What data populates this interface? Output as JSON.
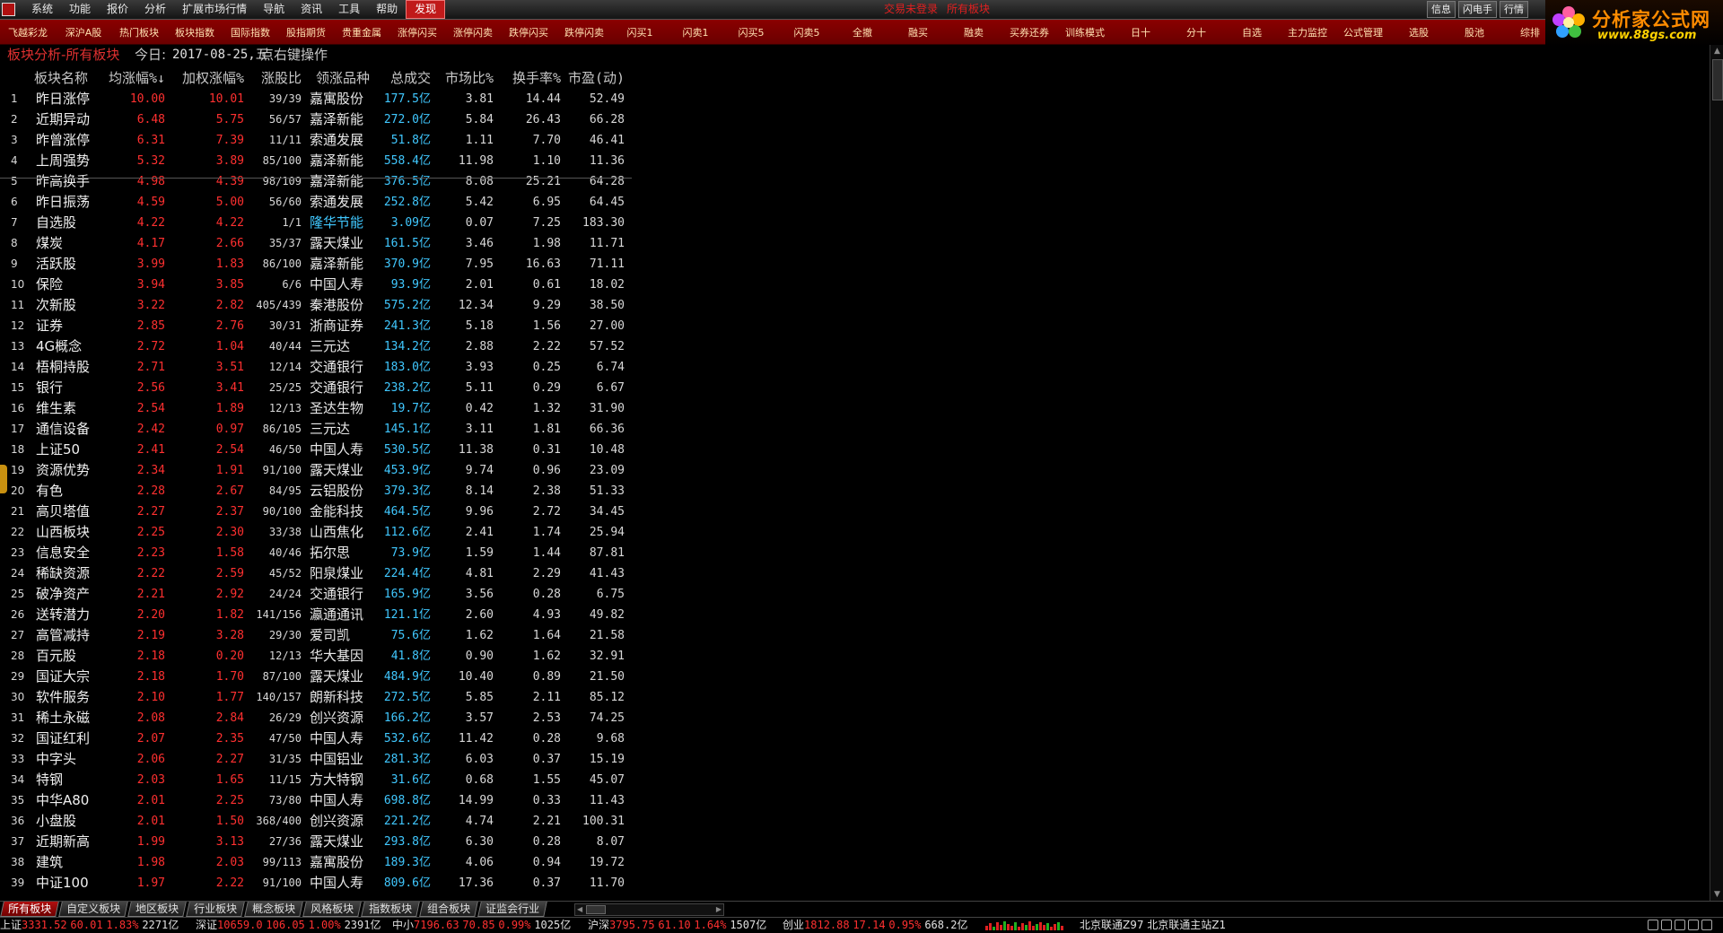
{
  "menubar": {
    "items": [
      "系统",
      "功能",
      "报价",
      "分析",
      "扩展市场行情",
      "导航",
      "资讯",
      "工具",
      "帮助",
      "发现"
    ],
    "status_msg": "交易未登录",
    "status_scope": "所有板块",
    "right_buttons": [
      "信息",
      "闪电手",
      "行情"
    ]
  },
  "brand": {
    "title": "分析家公式网",
    "url": "www.88gs.com"
  },
  "toolbar": {
    "items": [
      "飞越彩龙",
      "深沪A股",
      "热门板块",
      "板块指数",
      "国际指数",
      "股指期货",
      "贵重金属",
      "涨停闪买",
      "涨停闪卖",
      "跌停闪买",
      "跌停闪卖",
      "闪买1",
      "闪卖1",
      "闪买5",
      "闪卖5",
      "全撤",
      "融买",
      "融卖",
      "买券还券",
      "训练模式",
      "日十",
      "分十",
      "自选",
      "主力监控",
      "公式管理",
      "选股",
      "股池",
      "综排"
    ]
  },
  "panel": {
    "title": "板块分析-所有板块",
    "today_label": "今日:",
    "today_date": "2017-08-25,五",
    "hint": "点右键操作"
  },
  "table": {
    "headers": {
      "name": "板块名称",
      "avg": "均涨幅%",
      "weighted": "加权涨幅%",
      "ratio": "涨股比",
      "leader": "领涨品种",
      "volume": "总成交",
      "market": "市场比%",
      "turnover": "换手率%",
      "pe": "市盈(动)"
    },
    "rows": [
      {
        "idx": "1",
        "name": "昨日涨停",
        "avg": "10.00",
        "weighted": "10.01",
        "ratio": "39/39",
        "leader": "嘉寓股份",
        "volume": "177.5亿",
        "market": "3.81",
        "turnover": "14.44",
        "pe": "52.49"
      },
      {
        "idx": "2",
        "name": "近期异动",
        "avg": "6.48",
        "weighted": "5.75",
        "ratio": "56/57",
        "leader": "嘉泽新能",
        "volume": "272.0亿",
        "market": "5.84",
        "turnover": "26.43",
        "pe": "66.28"
      },
      {
        "idx": "3",
        "name": "昨曾涨停",
        "avg": "6.31",
        "weighted": "7.39",
        "ratio": "11/11",
        "leader": "索通发展",
        "volume": "51.8亿",
        "market": "1.11",
        "turnover": "7.70",
        "pe": "46.41"
      },
      {
        "idx": "4",
        "name": "上周强势",
        "avg": "5.32",
        "weighted": "3.89",
        "ratio": "85/100",
        "leader": "嘉泽新能",
        "volume": "558.4亿",
        "market": "11.98",
        "turnover": "1.10",
        "pe": "11.36"
      },
      {
        "idx": "5",
        "name": "昨高换手",
        "avg": "4.98",
        "weighted": "4.39",
        "ratio": "98/109",
        "leader": "嘉泽新能",
        "volume": "376.5亿",
        "market": "8.08",
        "turnover": "25.21",
        "pe": "64.28"
      },
      {
        "idx": "6",
        "name": "昨日振荡",
        "avg": "4.59",
        "weighted": "5.00",
        "ratio": "56/60",
        "leader": "索通发展",
        "volume": "252.8亿",
        "market": "5.42",
        "turnover": "6.95",
        "pe": "64.45"
      },
      {
        "idx": "7",
        "name": "自选股",
        "avg": "4.22",
        "weighted": "4.22",
        "ratio": "1/1",
        "leader": "隆华节能",
        "leader_cyan": true,
        "volume": "3.09亿",
        "market": "0.07",
        "turnover": "7.25",
        "pe": "183.30"
      },
      {
        "idx": "8",
        "name": "煤炭",
        "avg": "4.17",
        "weighted": "2.66",
        "ratio": "35/37",
        "leader": "露天煤业",
        "volume": "161.5亿",
        "market": "3.46",
        "turnover": "1.98",
        "pe": "11.71"
      },
      {
        "idx": "9",
        "name": "活跃股",
        "avg": "3.99",
        "weighted": "1.83",
        "ratio": "86/100",
        "leader": "嘉泽新能",
        "volume": "370.9亿",
        "market": "7.95",
        "turnover": "16.63",
        "pe": "71.11"
      },
      {
        "idx": "10",
        "name": "保险",
        "avg": "3.94",
        "weighted": "3.85",
        "ratio": "6/6",
        "leader": "中国人寿",
        "volume": "93.9亿",
        "market": "2.01",
        "turnover": "0.61",
        "pe": "18.02"
      },
      {
        "idx": "11",
        "name": "次新股",
        "avg": "3.22",
        "weighted": "2.82",
        "ratio": "405/439",
        "leader": "秦港股份",
        "volume": "575.2亿",
        "market": "12.34",
        "turnover": "9.29",
        "pe": "38.50"
      },
      {
        "idx": "12",
        "name": "证券",
        "avg": "2.85",
        "weighted": "2.76",
        "ratio": "30/31",
        "leader": "浙商证券",
        "volume": "241.3亿",
        "market": "5.18",
        "turnover": "1.56",
        "pe": "27.00"
      },
      {
        "idx": "13",
        "name": "4G概念",
        "avg": "2.72",
        "weighted": "1.04",
        "ratio": "40/44",
        "leader": "三元达",
        "volume": "134.2亿",
        "market": "2.88",
        "turnover": "2.22",
        "pe": "57.52"
      },
      {
        "idx": "14",
        "name": "梧桐持股",
        "avg": "2.71",
        "weighted": "3.51",
        "ratio": "12/14",
        "leader": "交通银行",
        "volume": "183.0亿",
        "market": "3.93",
        "turnover": "0.25",
        "pe": "6.74"
      },
      {
        "idx": "15",
        "name": "银行",
        "avg": "2.56",
        "weighted": "3.41",
        "ratio": "25/25",
        "leader": "交通银行",
        "volume": "238.2亿",
        "market": "5.11",
        "turnover": "0.29",
        "pe": "6.67"
      },
      {
        "idx": "16",
        "name": "维生素",
        "avg": "2.54",
        "weighted": "1.89",
        "ratio": "12/13",
        "leader": "圣达生物",
        "volume": "19.7亿",
        "market": "0.42",
        "turnover": "1.32",
        "pe": "31.90"
      },
      {
        "idx": "17",
        "name": "通信设备",
        "avg": "2.42",
        "weighted": "0.97",
        "ratio": "86/105",
        "leader": "三元达",
        "volume": "145.1亿",
        "market": "3.11",
        "turnover": "1.81",
        "pe": "66.36"
      },
      {
        "idx": "18",
        "name": "上证50",
        "avg": "2.41",
        "weighted": "2.54",
        "ratio": "46/50",
        "leader": "中国人寿",
        "volume": "530.5亿",
        "market": "11.38",
        "turnover": "0.31",
        "pe": "10.48"
      },
      {
        "idx": "19",
        "name": "资源优势",
        "avg": "2.34",
        "weighted": "1.91",
        "ratio": "91/100",
        "leader": "露天煤业",
        "volume": "453.9亿",
        "market": "9.74",
        "turnover": "0.96",
        "pe": "23.09"
      },
      {
        "idx": "20",
        "name": "有色",
        "avg": "2.28",
        "weighted": "2.67",
        "ratio": "84/95",
        "leader": "云铝股份",
        "volume": "379.3亿",
        "market": "8.14",
        "turnover": "2.38",
        "pe": "51.33"
      },
      {
        "idx": "21",
        "name": "高贝塔值",
        "avg": "2.27",
        "weighted": "2.37",
        "ratio": "90/100",
        "leader": "金能科技",
        "volume": "464.5亿",
        "market": "9.96",
        "turnover": "2.72",
        "pe": "34.45"
      },
      {
        "idx": "22",
        "name": "山西板块",
        "avg": "2.25",
        "weighted": "2.30",
        "ratio": "33/38",
        "leader": "山西焦化",
        "volume": "112.6亿",
        "market": "2.41",
        "turnover": "1.74",
        "pe": "25.94"
      },
      {
        "idx": "23",
        "name": "信息安全",
        "avg": "2.23",
        "weighted": "1.58",
        "ratio": "40/46",
        "leader": "拓尔思",
        "volume": "73.9亿",
        "market": "1.59",
        "turnover": "1.44",
        "pe": "87.81"
      },
      {
        "idx": "24",
        "name": "稀缺资源",
        "avg": "2.22",
        "weighted": "2.59",
        "ratio": "45/52",
        "leader": "阳泉煤业",
        "volume": "224.4亿",
        "market": "4.81",
        "turnover": "2.29",
        "pe": "41.43"
      },
      {
        "idx": "25",
        "name": "破净资产",
        "avg": "2.21",
        "weighted": "2.92",
        "ratio": "24/24",
        "leader": "交通银行",
        "volume": "165.9亿",
        "market": "3.56",
        "turnover": "0.28",
        "pe": "6.75"
      },
      {
        "idx": "26",
        "name": "送转潜力",
        "avg": "2.20",
        "weighted": "1.82",
        "ratio": "141/156",
        "leader": "瀛通通讯",
        "volume": "121.1亿",
        "market": "2.60",
        "turnover": "4.93",
        "pe": "49.82"
      },
      {
        "idx": "27",
        "name": "高管减持",
        "avg": "2.19",
        "weighted": "3.28",
        "ratio": "29/30",
        "leader": "爱司凯",
        "volume": "75.6亿",
        "market": "1.62",
        "turnover": "1.64",
        "pe": "21.58"
      },
      {
        "idx": "28",
        "name": "百元股",
        "avg": "2.18",
        "weighted": "0.20",
        "ratio": "12/13",
        "leader": "华大基因",
        "volume": "41.8亿",
        "market": "0.90",
        "turnover": "1.62",
        "pe": "32.91"
      },
      {
        "idx": "29",
        "name": "国证大宗",
        "avg": "2.18",
        "weighted": "1.70",
        "ratio": "87/100",
        "leader": "露天煤业",
        "volume": "484.9亿",
        "market": "10.40",
        "turnover": "0.89",
        "pe": "21.50"
      },
      {
        "idx": "30",
        "name": "软件服务",
        "avg": "2.10",
        "weighted": "1.77",
        "ratio": "140/157",
        "leader": "朗新科技",
        "volume": "272.5亿",
        "market": "5.85",
        "turnover": "2.11",
        "pe": "85.12"
      },
      {
        "idx": "31",
        "name": "稀土永磁",
        "avg": "2.08",
        "weighted": "2.84",
        "ratio": "26/29",
        "leader": "创兴资源",
        "volume": "166.2亿",
        "market": "3.57",
        "turnover": "2.53",
        "pe": "74.25"
      },
      {
        "idx": "32",
        "name": "国证红利",
        "avg": "2.07",
        "weighted": "2.35",
        "ratio": "47/50",
        "leader": "中国人寿",
        "volume": "532.6亿",
        "market": "11.42",
        "turnover": "0.28",
        "pe": "9.68"
      },
      {
        "idx": "33",
        "name": "中字头",
        "avg": "2.06",
        "weighted": "2.27",
        "ratio": "31/35",
        "leader": "中国铝业",
        "volume": "281.3亿",
        "market": "6.03",
        "turnover": "0.37",
        "pe": "15.19"
      },
      {
        "idx": "34",
        "name": "特钢",
        "avg": "2.03",
        "weighted": "1.65",
        "ratio": "11/15",
        "leader": "方大特钢",
        "volume": "31.6亿",
        "market": "0.68",
        "turnover": "1.55",
        "pe": "45.07"
      },
      {
        "idx": "35",
        "name": "中华A80",
        "avg": "2.01",
        "weighted": "2.25",
        "ratio": "73/80",
        "leader": "中国人寿",
        "volume": "698.8亿",
        "market": "14.99",
        "turnover": "0.33",
        "pe": "11.43"
      },
      {
        "idx": "36",
        "name": "小盘股",
        "avg": "2.01",
        "weighted": "1.50",
        "ratio": "368/400",
        "leader": "创兴资源",
        "volume": "221.2亿",
        "market": "4.74",
        "turnover": "2.21",
        "pe": "100.31"
      },
      {
        "idx": "37",
        "name": "近期新高",
        "avg": "1.99",
        "weighted": "3.13",
        "ratio": "27/36",
        "leader": "露天煤业",
        "volume": "293.8亿",
        "market": "6.30",
        "turnover": "0.28",
        "pe": "8.07"
      },
      {
        "idx": "38",
        "name": "建筑",
        "avg": "1.98",
        "weighted": "2.03",
        "ratio": "99/113",
        "leader": "嘉寓股份",
        "volume": "189.3亿",
        "market": "4.06",
        "turnover": "0.94",
        "pe": "19.72"
      },
      {
        "idx": "39",
        "name": "中证100",
        "avg": "1.97",
        "weighted": "2.22",
        "ratio": "91/100",
        "leader": "中国人寿",
        "volume": "809.6亿",
        "market": "17.36",
        "turnover": "0.37",
        "pe": "11.70"
      }
    ]
  },
  "tabs": [
    "所有板块",
    "自定义板块",
    "地区板块",
    "行业板块",
    "概念板块",
    "风格板块",
    "指数板块",
    "组合板块",
    "证监会行业"
  ],
  "ticker": {
    "sh": {
      "label": "上证",
      "value": "3331.52",
      "chg": "60.01",
      "pct": "1.83%",
      "amount": "2271亿"
    },
    "sz": {
      "label": "深证",
      "value": "10659.0",
      "chg": "106.05",
      "pct": "1.00%",
      "amount": "2391亿"
    },
    "zx": {
      "label": "中小",
      "value": "7196.63",
      "chg": "70.85",
      "pct": "0.99%",
      "amount": "1025亿"
    },
    "hs": {
      "label": "沪深",
      "value": "3795.75",
      "chg": "61.10",
      "pct": "1.64%",
      "amount": "1507亿"
    },
    "cy": {
      "label": "创业",
      "value": "1812.88",
      "chg": "17.14",
      "pct": "0.95%",
      "amount": "668.2亿"
    },
    "connection": "北京联通Z97  北京联通主站Z1"
  },
  "colors": {
    "up": "#ff3030",
    "volume": "#40c8ff",
    "title": "#e03030",
    "toolbar_bg": "#7a0000",
    "brand_orange": "#ff8c00"
  },
  "icons": [
    "app-logo-icon",
    "flower-logo-icon",
    "sort-desc-icon",
    "scroll-up-icon",
    "scroll-down-icon",
    "scroll-left-icon",
    "scroll-right-icon",
    "panel-handle-icon"
  ]
}
